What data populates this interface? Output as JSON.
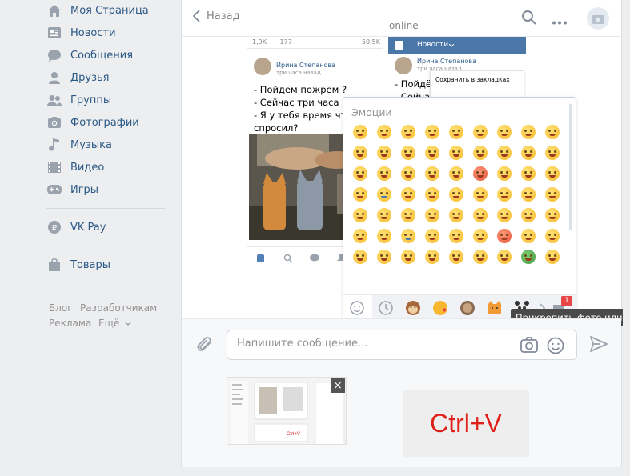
{
  "sidebar": {
    "items": [
      {
        "label": "Моя Страница",
        "icon": "home-icon"
      },
      {
        "label": "Новости",
        "icon": "news-icon"
      },
      {
        "label": "Сообщения",
        "icon": "messages-icon"
      },
      {
        "label": "Друзья",
        "icon": "friends-icon"
      },
      {
        "label": "Группы",
        "icon": "groups-icon"
      },
      {
        "label": "Фотографии",
        "icon": "camera-icon"
      },
      {
        "label": "Музыка",
        "icon": "music-note-icon"
      },
      {
        "label": "Видео",
        "icon": "video-icon"
      },
      {
        "label": "Игры",
        "icon": "gamepad-icon"
      }
    ],
    "pay": {
      "label": "VK Pay",
      "icon": "ruble-icon"
    },
    "goods": {
      "label": "Товары",
      "icon": "shopping-bag-icon"
    },
    "footer": {
      "blog": "Блог",
      "dev": "Разработчикам",
      "ads": "Реклама",
      "more": "Ещё"
    }
  },
  "header": {
    "back_label": "Назад",
    "status": "online"
  },
  "shared_image": {
    "post_stats": [
      "1,9K",
      "177",
      "50,5K"
    ],
    "author": "Ирина Степанова",
    "time": "три часа назад",
    "lines": [
      "- Пойдём пожрём ?",
      "- Сейчас три часа ночи",
      "- Я у тебя время что ли",
      "спросил?"
    ],
    "right_title": "Новости",
    "right_author": "Ирина Степанова",
    "right_time": "три часа назад",
    "right_line1": "- Пойдём",
    "right_line2": "- Сейчас",
    "menu_item": "Сохранить в закладках"
  },
  "emoji_panel": {
    "title": "Эмоции",
    "badge": "1"
  },
  "tooltip": "Прикрепить фото или видео",
  "composer": {
    "placeholder": "Напишите сообщение..."
  },
  "attachment": {
    "close": "×",
    "ctrl_label": "Ctrl+V"
  }
}
